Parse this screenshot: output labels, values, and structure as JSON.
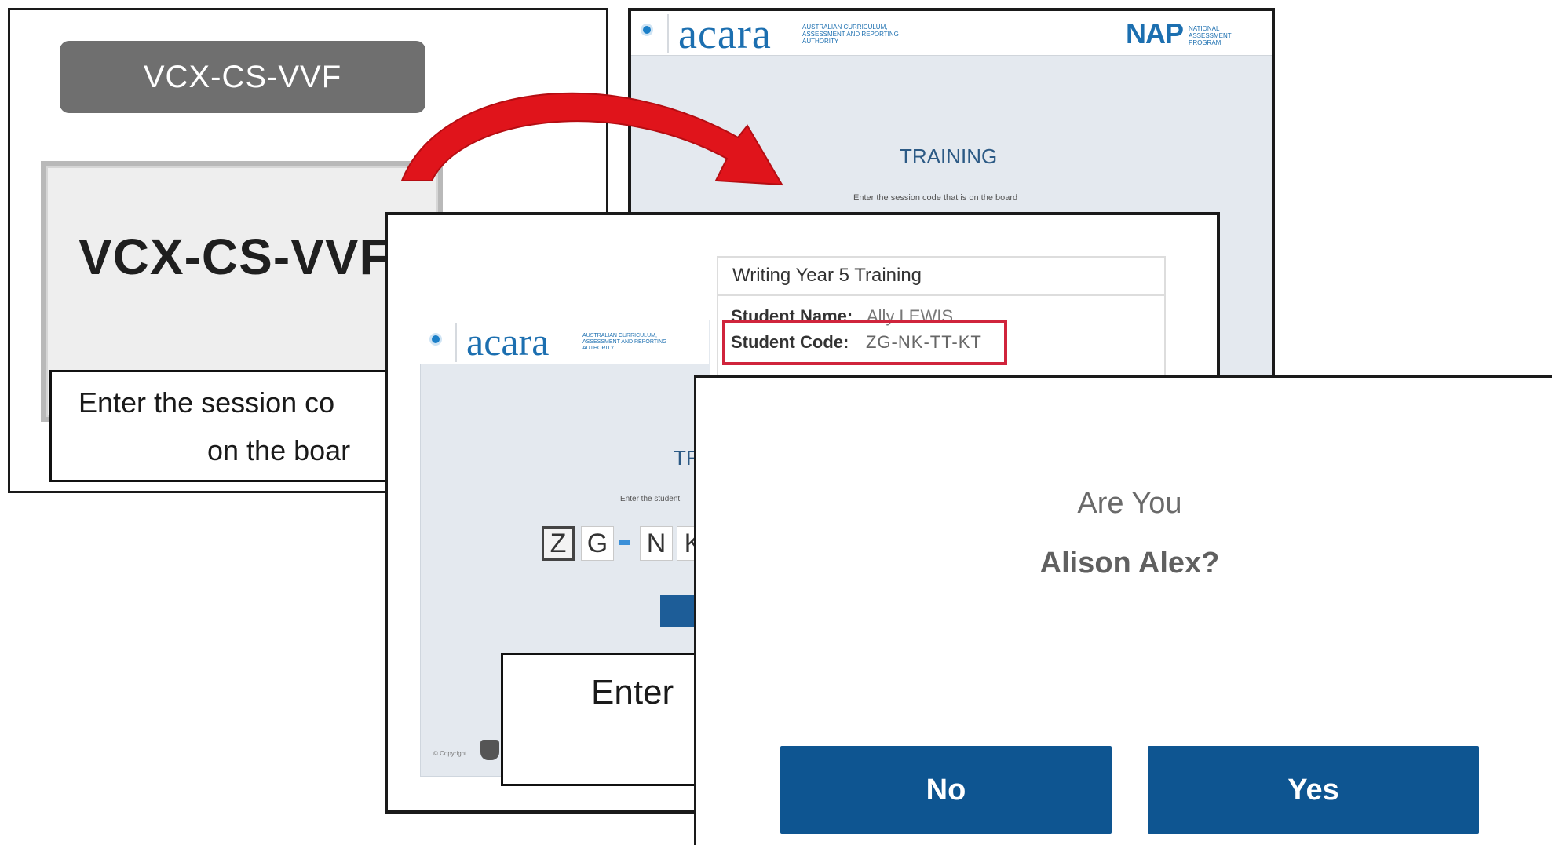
{
  "panel1": {
    "chip_code": "VCX-CS-VVF",
    "board_code": "VCX-CS-VVF",
    "caption_line1": "Enter the session co",
    "caption_line2": "on the boar"
  },
  "panel2": {
    "logo": "acara",
    "logo_subtitle": "AUSTRALIAN CURRICULUM, ASSESSMENT AND REPORTING AUTHORITY",
    "nap_logo": "NAP",
    "nap_subtitle": "NATIONAL ASSESSMENT PROGRAM",
    "title": "TRAINING",
    "instruction": "Enter the session code that is on the board"
  },
  "panel3": {
    "logo": "acara",
    "logo_subtitle": "AUSTRALIAN CURRICULUM, ASSESSMENT AND REPORTING AUTHORITY",
    "title_partial": "TR",
    "hint_partial": "Enter the student",
    "code_chars": [
      "Z",
      "G",
      "N",
      "K"
    ],
    "copyright": "© Copyright",
    "info": {
      "title": "Writing Year 5 Training",
      "student_name_label": "Student Name:",
      "student_name_value": "Ally LEWIS",
      "student_code_label": "Student Code:",
      "student_code_value": "ZG-NK-TT-KT"
    },
    "caption_partial": "Enter"
  },
  "panel4": {
    "question_line1": "Are You",
    "question_line2": "Alison Alex?",
    "no_label": "No",
    "yes_label": "Yes"
  },
  "colors": {
    "acara_blue": "#1c6fb0",
    "button_blue": "#0e5591",
    "highlight_red": "#d0243c",
    "arrow_red": "#e0141b"
  }
}
